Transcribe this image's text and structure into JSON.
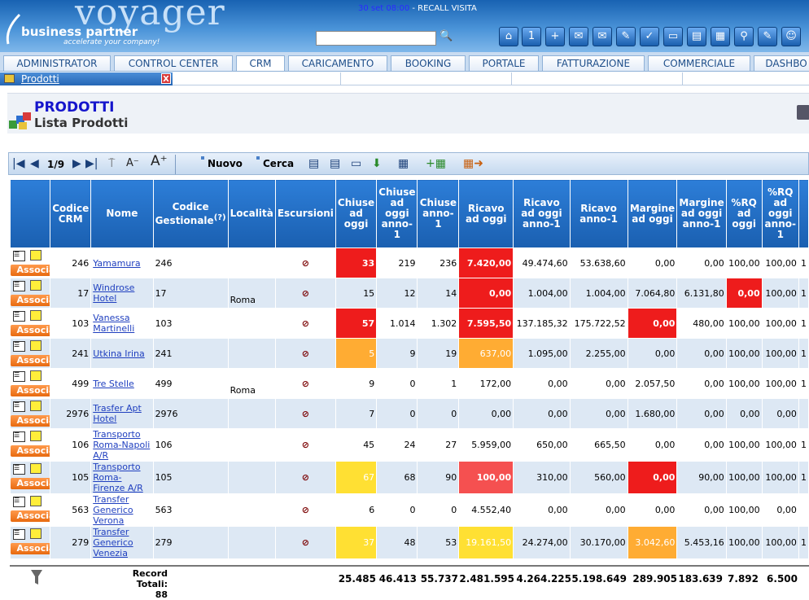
{
  "header": {
    "brand": "voyager",
    "brand_sub": "business partner",
    "tagline": "accelerate your company!",
    "recall_time": "30 set 08:00",
    "recall_label": " - RECALL VISITA",
    "search_placeholder": ""
  },
  "nav": {
    "tabs": [
      "ADMINISTRATOR",
      "CONTROL CENTER",
      "CRM",
      "CARICAMENTO",
      "BOOKING",
      "PORTALE",
      "FATTURAZIONE",
      "COMMERCIALE",
      "DASHBO"
    ]
  },
  "open_tab": {
    "label": "Prodotti",
    "close": "X"
  },
  "page": {
    "title": "PRODOTTI",
    "subtitle": "Lista Prodotti"
  },
  "toolbar": {
    "page_count": "1/9",
    "new_label": "Nuovo",
    "search_label": "Cerca"
  },
  "table": {
    "headers": [
      "",
      "Codice CRM",
      "Nome",
      "Codice Gestionale(?)",
      "Località",
      "Escursioni",
      "Chiuse ad oggi",
      "Chiuse ad oggi anno-1",
      "Chiuse anno-1",
      "Ricavo ad oggi",
      "Ricavo ad oggi anno-1",
      "Ricavo anno-1",
      "Margine ad oggi",
      "Margine ad oggi anno-1",
      "%RQ ad oggi",
      "%RQ ad oggi anno-1",
      ""
    ],
    "assoc_label": "Associa",
    "rows": [
      {
        "crm": "246",
        "nome": "Yamamura",
        "gest": "246",
        "loc": "",
        "chiuse": "33",
        "chiuse_a1": "219",
        "chiuse_y1": "236",
        "ricavo": "7.420,00",
        "ricavo_a1": "49.474,60",
        "ricavo_y1": "53.638,60",
        "margine": "0,00",
        "margine_a1": "0,00",
        "rq": "100,00",
        "rq_a1": "100,00",
        "extra": "1"
      },
      {
        "crm": "17",
        "nome": "Windrose Hotel",
        "gest": "17",
        "loc": "Roma",
        "chiuse": "15",
        "chiuse_a1": "12",
        "chiuse_y1": "14",
        "ricavo": "0,00",
        "ricavo_a1": "1.004,00",
        "ricavo_y1": "1.004,00",
        "margine": "7.064,80",
        "margine_a1": "6.131,80",
        "rq": "0,00",
        "rq_a1": "100,00",
        "extra": "1"
      },
      {
        "crm": "103",
        "nome": "Vanessa Martinelli",
        "gest": "103",
        "loc": "",
        "chiuse": "57",
        "chiuse_a1": "1.014",
        "chiuse_y1": "1.302",
        "ricavo": "7.595,50",
        "ricavo_a1": "137.185,32",
        "ricavo_y1": "175.722,52",
        "margine": "0,00",
        "margine_a1": "480,00",
        "rq": "100,00",
        "rq_a1": "100,00",
        "extra": "1"
      },
      {
        "crm": "241",
        "nome": "Utkina Irina",
        "gest": "241",
        "loc": "",
        "chiuse": "5",
        "chiuse_a1": "9",
        "chiuse_y1": "19",
        "ricavo": "637,00",
        "ricavo_a1": "1.095,00",
        "ricavo_y1": "2.255,00",
        "margine": "0,00",
        "margine_a1": "0,00",
        "rq": "100,00",
        "rq_a1": "100,00",
        "extra": "1"
      },
      {
        "crm": "499",
        "nome": "Tre Stelle",
        "gest": "499",
        "loc": "Roma",
        "chiuse": "9",
        "chiuse_a1": "0",
        "chiuse_y1": "1",
        "ricavo": "172,00",
        "ricavo_a1": "0,00",
        "ricavo_y1": "0,00",
        "margine": "2.057,50",
        "margine_a1": "0,00",
        "rq": "100,00",
        "rq_a1": "100,00",
        "extra": "1"
      },
      {
        "crm": "2976",
        "nome": "Trasfer Apt Hotel",
        "gest": "2976",
        "loc": "",
        "chiuse": "7",
        "chiuse_a1": "0",
        "chiuse_y1": "0",
        "ricavo": "0,00",
        "ricavo_a1": "0,00",
        "ricavo_y1": "0,00",
        "margine": "1.680,00",
        "margine_a1": "0,00",
        "rq": "0,00",
        "rq_a1": "0,00",
        "extra": ""
      },
      {
        "crm": "106",
        "nome": "Transporto Roma-Napoli A/R",
        "gest": "106",
        "loc": "",
        "chiuse": "45",
        "chiuse_a1": "24",
        "chiuse_y1": "27",
        "ricavo": "5.959,00",
        "ricavo_a1": "650,00",
        "ricavo_y1": "665,50",
        "margine": "0,00",
        "margine_a1": "0,00",
        "rq": "100,00",
        "rq_a1": "100,00",
        "extra": "1"
      },
      {
        "crm": "105",
        "nome": "Transporto Roma-Firenze A/R",
        "gest": "105",
        "loc": "",
        "chiuse": "67",
        "chiuse_a1": "68",
        "chiuse_y1": "90",
        "ricavo": "100,00",
        "ricavo_a1": "310,00",
        "ricavo_y1": "560,00",
        "margine": "0,00",
        "margine_a1": "90,00",
        "rq": "100,00",
        "rq_a1": "100,00",
        "extra": "1"
      },
      {
        "crm": "563",
        "nome": "Transfer Generico Verona",
        "gest": "563",
        "loc": "",
        "chiuse": "6",
        "chiuse_a1": "0",
        "chiuse_y1": "0",
        "ricavo": "4.552,40",
        "ricavo_a1": "0,00",
        "ricavo_y1": "0,00",
        "margine": "0,00",
        "margine_a1": "0,00",
        "rq": "100,00",
        "rq_a1": "0,00",
        "extra": ""
      },
      {
        "crm": "279",
        "nome": "Transfer Generico Venezia",
        "gest": "279",
        "loc": "",
        "chiuse": "37",
        "chiuse_a1": "48",
        "chiuse_y1": "53",
        "ricavo": "19.161,50",
        "ricavo_a1": "24.274,00",
        "ricavo_y1": "30.170,00",
        "margine": "3.042,60",
        "margine_a1": "5.453,16",
        "rq": "100,00",
        "rq_a1": "100,00",
        "extra": "1"
      }
    ],
    "highlights": {
      "0": {
        "chiuse": "cred",
        "ricavo": "cred"
      },
      "1": {
        "ricavo": "cred",
        "rq": "cred"
      },
      "2": {
        "chiuse": "cred",
        "ricavo": "cred",
        "margine": "cred"
      },
      "3": {
        "chiuse": "corange",
        "ricavo": "corange"
      },
      "7": {
        "chiuse": "cyellow",
        "ricavo": "clred",
        "margine": "cred"
      },
      "9": {
        "chiuse": "cyellow",
        "ricavo": "cyellow",
        "margine": "corange"
      }
    }
  },
  "totals": {
    "label_line1": "Record",
    "label_line2": "Totali: 88",
    "values": [
      "25.485",
      "46.413",
      "55.737",
      "2.481.595",
      "4.264.225",
      "5.198.649",
      "289.905",
      "183.639",
      "7.892",
      "6.500"
    ]
  },
  "colors": {
    "header_blue": "#1862b2",
    "accent_red": "#ee1c1c",
    "accent_orange": "#ffac33",
    "accent_yellow": "#ffe033"
  }
}
